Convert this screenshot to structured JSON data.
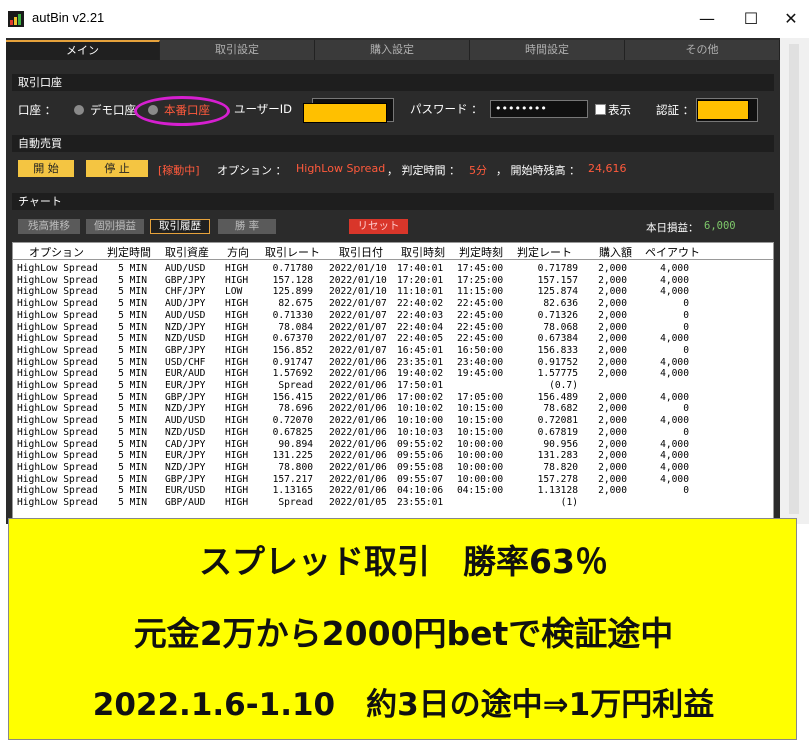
{
  "window": {
    "title": "autBin v2.21",
    "minimize": "—",
    "maximize": "☐",
    "close": "✕"
  },
  "tabs": [
    {
      "label": "メイン"
    },
    {
      "label": "取引設定"
    },
    {
      "label": "購入設定"
    },
    {
      "label": "時間設定"
    },
    {
      "label": "その他"
    }
  ],
  "account": {
    "header": "取引口座",
    "account_label": "口座 ：",
    "demo_label": "デモ口座",
    "real_label": "本番口座",
    "user_id_label": "ユーザーID",
    "password_label": "パスワード ：",
    "password_value": "••••••••",
    "show_label": "表示",
    "auth_label": "認証 ："
  },
  "auto": {
    "header": "自動売買",
    "start_label": "開 始",
    "stop_label": "停 止",
    "status": "[稼動中]",
    "option_label": "オプション ：",
    "option_value": "HighLow Spread",
    "judge_label": "， 判定時間 ：",
    "judge_value": "5分",
    "balance_label": "， 開始時残高 ：",
    "balance_value": "24,616"
  },
  "chart": {
    "header": "チャート",
    "buttons": [
      "残高推移",
      "個別損益",
      "取引履歴",
      "勝 率"
    ],
    "reset_label": "リセット",
    "today_label": "本日損益：",
    "today_value": "6,000"
  },
  "table": {
    "columns": [
      "オプション",
      "判定時間",
      "取引資産",
      "方向",
      "取引レート",
      "取引日付",
      "取引時刻",
      "判定時刻",
      "判定レート",
      "購入額",
      "ペイアウト"
    ],
    "rows": [
      [
        "HighLow Spread",
        "5 MIN",
        "AUD/USD",
        "HIGH",
        "0.71780",
        "2022/01/10",
        "17:40:01",
        "17:45:00",
        "0.71789",
        "2,000",
        "4,000"
      ],
      [
        "HighLow Spread",
        "5 MIN",
        "GBP/JPY",
        "HIGH",
        "157.128",
        "2022/01/10",
        "17:20:01",
        "17:25:00",
        "157.157",
        "2,000",
        "4,000"
      ],
      [
        "HighLow Spread",
        "5 MIN",
        "CHF/JPY",
        "LOW",
        "125.899",
        "2022/01/10",
        "11:10:01",
        "11:15:00",
        "125.874",
        "2,000",
        "4,000"
      ],
      [
        "HighLow Spread",
        "5 MIN",
        "AUD/JPY",
        "HIGH",
        "82.675",
        "2022/01/07",
        "22:40:02",
        "22:45:00",
        "82.636",
        "2,000",
        "0"
      ],
      [
        "HighLow Spread",
        "5 MIN",
        "AUD/USD",
        "HIGH",
        "0.71330",
        "2022/01/07",
        "22:40:03",
        "22:45:00",
        "0.71326",
        "2,000",
        "0"
      ],
      [
        "HighLow Spread",
        "5 MIN",
        "NZD/JPY",
        "HIGH",
        "78.084",
        "2022/01/07",
        "22:40:04",
        "22:45:00",
        "78.068",
        "2,000",
        "0"
      ],
      [
        "HighLow Spread",
        "5 MIN",
        "NZD/USD",
        "HIGH",
        "0.67370",
        "2022/01/07",
        "22:40:05",
        "22:45:00",
        "0.67384",
        "2,000",
        "4,000"
      ],
      [
        "HighLow Spread",
        "5 MIN",
        "GBP/JPY",
        "HIGH",
        "156.852",
        "2022/01/07",
        "16:45:01",
        "16:50:00",
        "156.833",
        "2,000",
        "0"
      ],
      [
        "HighLow Spread",
        "5 MIN",
        "USD/CHF",
        "HIGH",
        "0.91747",
        "2022/01/06",
        "23:35:01",
        "23:40:00",
        "0.91752",
        "2,000",
        "4,000"
      ],
      [
        "HighLow Spread",
        "5 MIN",
        "EUR/AUD",
        "HIGH",
        "1.57692",
        "2022/01/06",
        "19:40:02",
        "19:45:00",
        "1.57775",
        "2,000",
        "4,000"
      ],
      [
        "HighLow Spread",
        "5 MIN",
        "EUR/JPY",
        "HIGH",
        "Spread",
        "2022/01/06",
        "17:50:01",
        "",
        "(0.7)",
        "",
        ""
      ],
      [
        "HighLow Spread",
        "5 MIN",
        "GBP/JPY",
        "HIGH",
        "156.415",
        "2022/01/06",
        "17:00:02",
        "17:05:00",
        "156.489",
        "2,000",
        "4,000"
      ],
      [
        "HighLow Spread",
        "5 MIN",
        "NZD/JPY",
        "HIGH",
        "78.696",
        "2022/01/06",
        "10:10:02",
        "10:15:00",
        "78.682",
        "2,000",
        "0"
      ],
      [
        "HighLow Spread",
        "5 MIN",
        "AUD/USD",
        "HIGH",
        "0.72070",
        "2022/01/06",
        "10:10:00",
        "10:15:00",
        "0.72081",
        "2,000",
        "4,000"
      ],
      [
        "HighLow Spread",
        "5 MIN",
        "NZD/USD",
        "HIGH",
        "0.67825",
        "2022/01/06",
        "10:10:03",
        "10:15:00",
        "0.67819",
        "2,000",
        "0"
      ],
      [
        "HighLow Spread",
        "5 MIN",
        "CAD/JPY",
        "HIGH",
        "90.894",
        "2022/01/06",
        "09:55:02",
        "10:00:00",
        "90.956",
        "2,000",
        "4,000"
      ],
      [
        "HighLow Spread",
        "5 MIN",
        "EUR/JPY",
        "HIGH",
        "131.225",
        "2022/01/06",
        "09:55:06",
        "10:00:00",
        "131.283",
        "2,000",
        "4,000"
      ],
      [
        "HighLow Spread",
        "5 MIN",
        "NZD/JPY",
        "HIGH",
        "78.800",
        "2022/01/06",
        "09:55:08",
        "10:00:00",
        "78.820",
        "2,000",
        "4,000"
      ],
      [
        "HighLow Spread",
        "5 MIN",
        "GBP/JPY",
        "HIGH",
        "157.217",
        "2022/01/06",
        "09:55:07",
        "10:00:00",
        "157.278",
        "2,000",
        "4,000"
      ],
      [
        "HighLow Spread",
        "5 MIN",
        "EUR/USD",
        "HIGH",
        "1.13165",
        "2022/01/06",
        "04:10:06",
        "04:15:00",
        "1.13128",
        "2,000",
        "0"
      ],
      [
        "HighLow Spread",
        "5 MIN",
        "GBP/AUD",
        "HIGH",
        "Spread",
        "2022/01/05",
        "23:55:01",
        "",
        "(1)",
        "",
        ""
      ]
    ]
  },
  "overlay": {
    "line1": "スプレッド取引　勝率63％",
    "line2": "元金2万から2000円betで検証途中",
    "line3": "2022.1.6-1.10　約3日の途中⇒1万円利益"
  },
  "colors": {
    "accent": "#ffc000",
    "highlight_ring": "#d61fd0",
    "overlay_bg": "#ffff00",
    "status_red": "#ff5a3c"
  }
}
